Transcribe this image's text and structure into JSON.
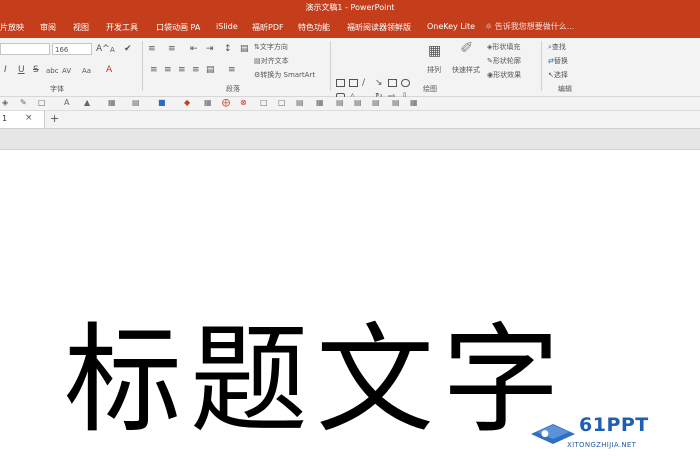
{
  "window": {
    "title": "演示文稿1 - PowerPoint"
  },
  "tabs": [
    "片放映",
    "审阅",
    "视图",
    "开发工具",
    "口袋动画 PA",
    "iSlide",
    "福昕PDF",
    "特色功能",
    "福昕阅读器领鲜版",
    "OneKey Lite"
  ],
  "tell_me": "告诉我您想要做什么...",
  "font_group": {
    "font_size": "166",
    "label": "字体",
    "grow_icon": "A^",
    "shrink_icon": "A",
    "format_icons": [
      "I",
      "U",
      "S",
      "abc",
      "AV",
      "Aa",
      "A"
    ]
  },
  "paragraph_group": {
    "label": "段落",
    "text_direction": "文字方向",
    "align_text": "对齐文本",
    "convert_smartart": "转换为 SmartArt"
  },
  "drawing_group": {
    "label": "绘图",
    "arrange": "排列",
    "quick_styles": "快速样式",
    "shape_fill": "形状填充",
    "shape_outline": "形状轮廓",
    "shape_effects": "形状效果"
  },
  "editing_group": {
    "label": "编辑",
    "find": "查找",
    "replace": "替换",
    "select": "选择"
  },
  "doc_tab": {
    "name": "1",
    "close": "×",
    "add": "+"
  },
  "slide": {
    "title": "标题文字"
  },
  "watermark": {
    "brand": "61PPT",
    "url": "XITONGZHIJIA.NET",
    "color": "#1f5fb3"
  },
  "colors": {
    "accent": "#c43e1c",
    "ribbon_bg": "#f3f3f3"
  }
}
